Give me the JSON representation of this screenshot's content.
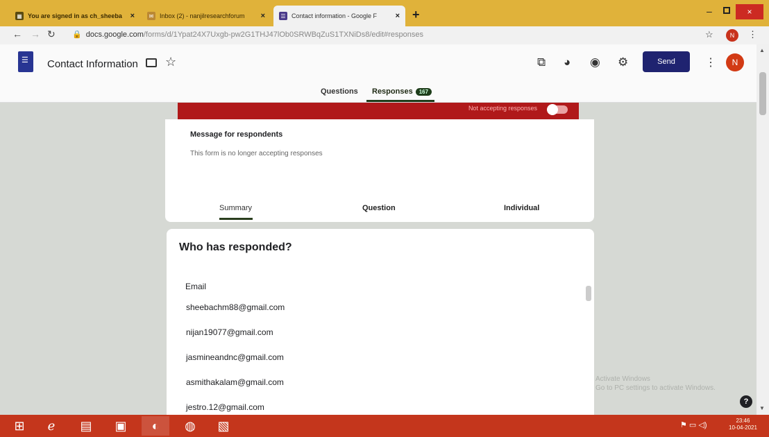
{
  "browser": {
    "tabs": [
      {
        "label": "You are signed in as ch_sheeba",
        "active": false
      },
      {
        "label": "Inbox (2) - nanjilresearchforum",
        "active": false
      },
      {
        "label": "Contact information - Google F",
        "active": true
      }
    ],
    "url_host": "docs.google.com",
    "url_path": "/forms/d/1Ypat24X7Uxgb-pw2G1THJ47lOb0SRWBqZuS1TXNiDs8/edit#responses",
    "profile_initial": "N"
  },
  "form_header": {
    "title": "Contact Information",
    "send_label": "Send",
    "avatar_initial": "N",
    "tabs": [
      {
        "label": "Questions",
        "active": false
      },
      {
        "label": "Responses",
        "active": true,
        "badge": "167"
      }
    ]
  },
  "responses_banner": {
    "label": "Not accepting responses"
  },
  "message_card": {
    "title": "Message for respondents",
    "text": "This form is no longer accepting responses",
    "subtabs": [
      {
        "label": "Summary",
        "active": true
      },
      {
        "label": "Question",
        "active": false
      },
      {
        "label": "Individual",
        "active": false
      }
    ]
  },
  "responders_card": {
    "title": "Who has responded?",
    "column_header": "Email",
    "emails": [
      "sheebachm88@gmail.com",
      "nijan19077@gmail.com",
      "jasmineandnc@gmail.com",
      "asmithakalam@gmail.com",
      "jestro.12@gmail.com"
    ]
  },
  "watermark": {
    "line1": "Activate Windows",
    "line2": "Go to PC settings to activate Windows."
  },
  "taskbar": {
    "clock_time": "23:46",
    "clock_date": "10-04-2021"
  },
  "colors": {
    "send_button": "#1f2370",
    "banner": "#b0191a",
    "taskbar": "#c4361c",
    "tabstrip": "#e0b23a"
  }
}
